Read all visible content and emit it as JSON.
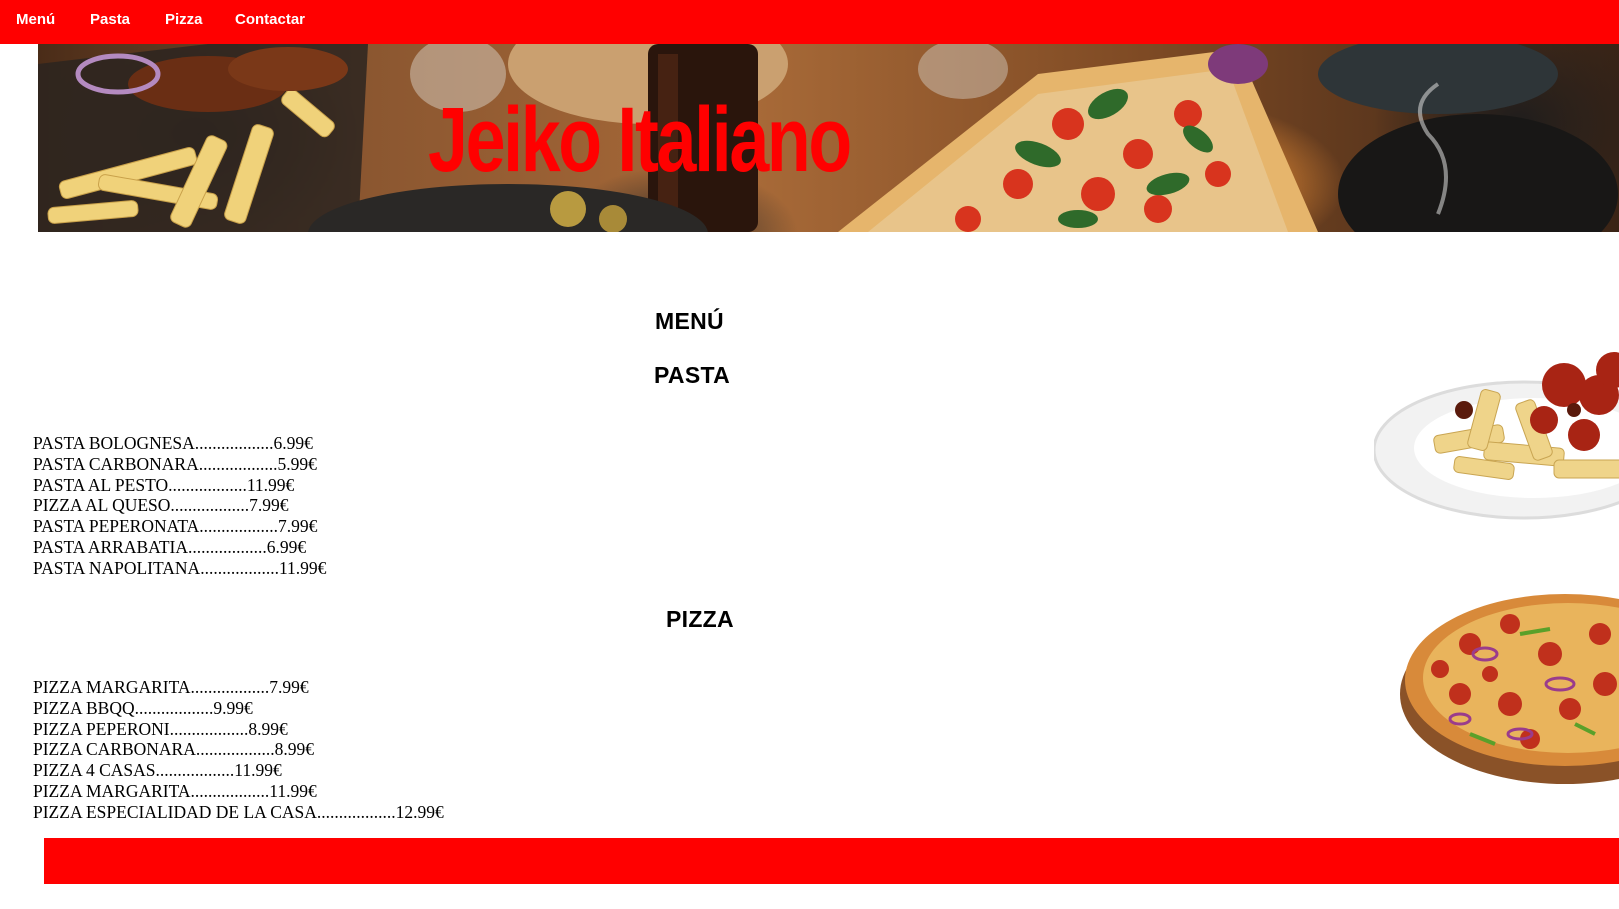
{
  "nav": {
    "items": [
      "Menú",
      "Pasta",
      "Pizza",
      "Contactar"
    ]
  },
  "hero": {
    "title": "Jeiko Italiano"
  },
  "main": {
    "menu_heading": "MENÚ",
    "pasta_heading": "PASTA",
    "pizza_heading": "PIZZA",
    "pasta_items": [
      "PASTA BOLOGNESA..................6.99€",
      "PASTA CARBONARA..................5.99€",
      "PASTA AL PESTO..................11.99€",
      "PIZZA AL QUESO..................7.99€",
      "PASTA PEPERONATA..................7.99€",
      "PASTA ARRABATIA..................6.99€",
      "PASTA NAPOLITANA..................11.99€"
    ],
    "pizza_items": [
      "PIZZA MARGARITA..................7.99€",
      "PIZZA BBQQ..................9.99€",
      "PIZZA PEPERONI..................8.99€",
      "PIZZA CARBONARA..................8.99€",
      "PIZZA 4 CASAS..................11.99€",
      "PIZZA MARGARITA..................11.99€",
      "PIZZA ESPECIALIDAD DE LA CASA..................12.99€"
    ]
  },
  "colors": {
    "brand_red": "#ff0000",
    "nav_text": "#ffffff"
  }
}
